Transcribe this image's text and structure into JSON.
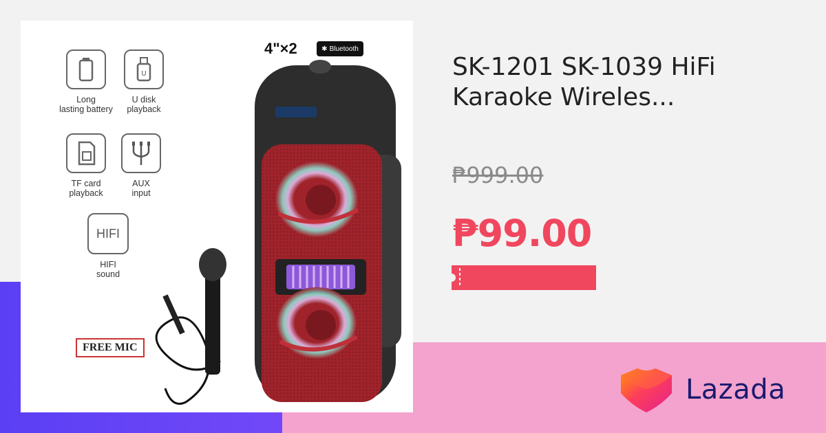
{
  "product": {
    "title": "SK-1201 SK-1039 HiFi Karaoke Wireles...",
    "original_price": "₱999.00",
    "sale_price": "₱99.00"
  },
  "image": {
    "spec": "4\"×2",
    "bluetooth_badge": "Bluetooth",
    "free_mic": "FREE MIC",
    "features": [
      {
        "label": "Long\nlasting battery",
        "icon": "battery-icon"
      },
      {
        "label": "U disk\nplayback",
        "icon": "usb-icon"
      },
      {
        "label": "TF card\nplayback",
        "icon": "sd-card-icon"
      },
      {
        "label": "AUX\ninput",
        "icon": "aux-cable-icon"
      },
      {
        "label": "HIFI\nsound",
        "icon": "hifi-icon",
        "icon_text": "HIFI"
      }
    ]
  },
  "brand": {
    "name": "Lazada"
  },
  "colors": {
    "price": "#f0475e",
    "brand_text": "#1a1a6e",
    "purple": "#5b3ff4",
    "pink": "#f3a3cd",
    "speaker_red": "#a0232b"
  }
}
